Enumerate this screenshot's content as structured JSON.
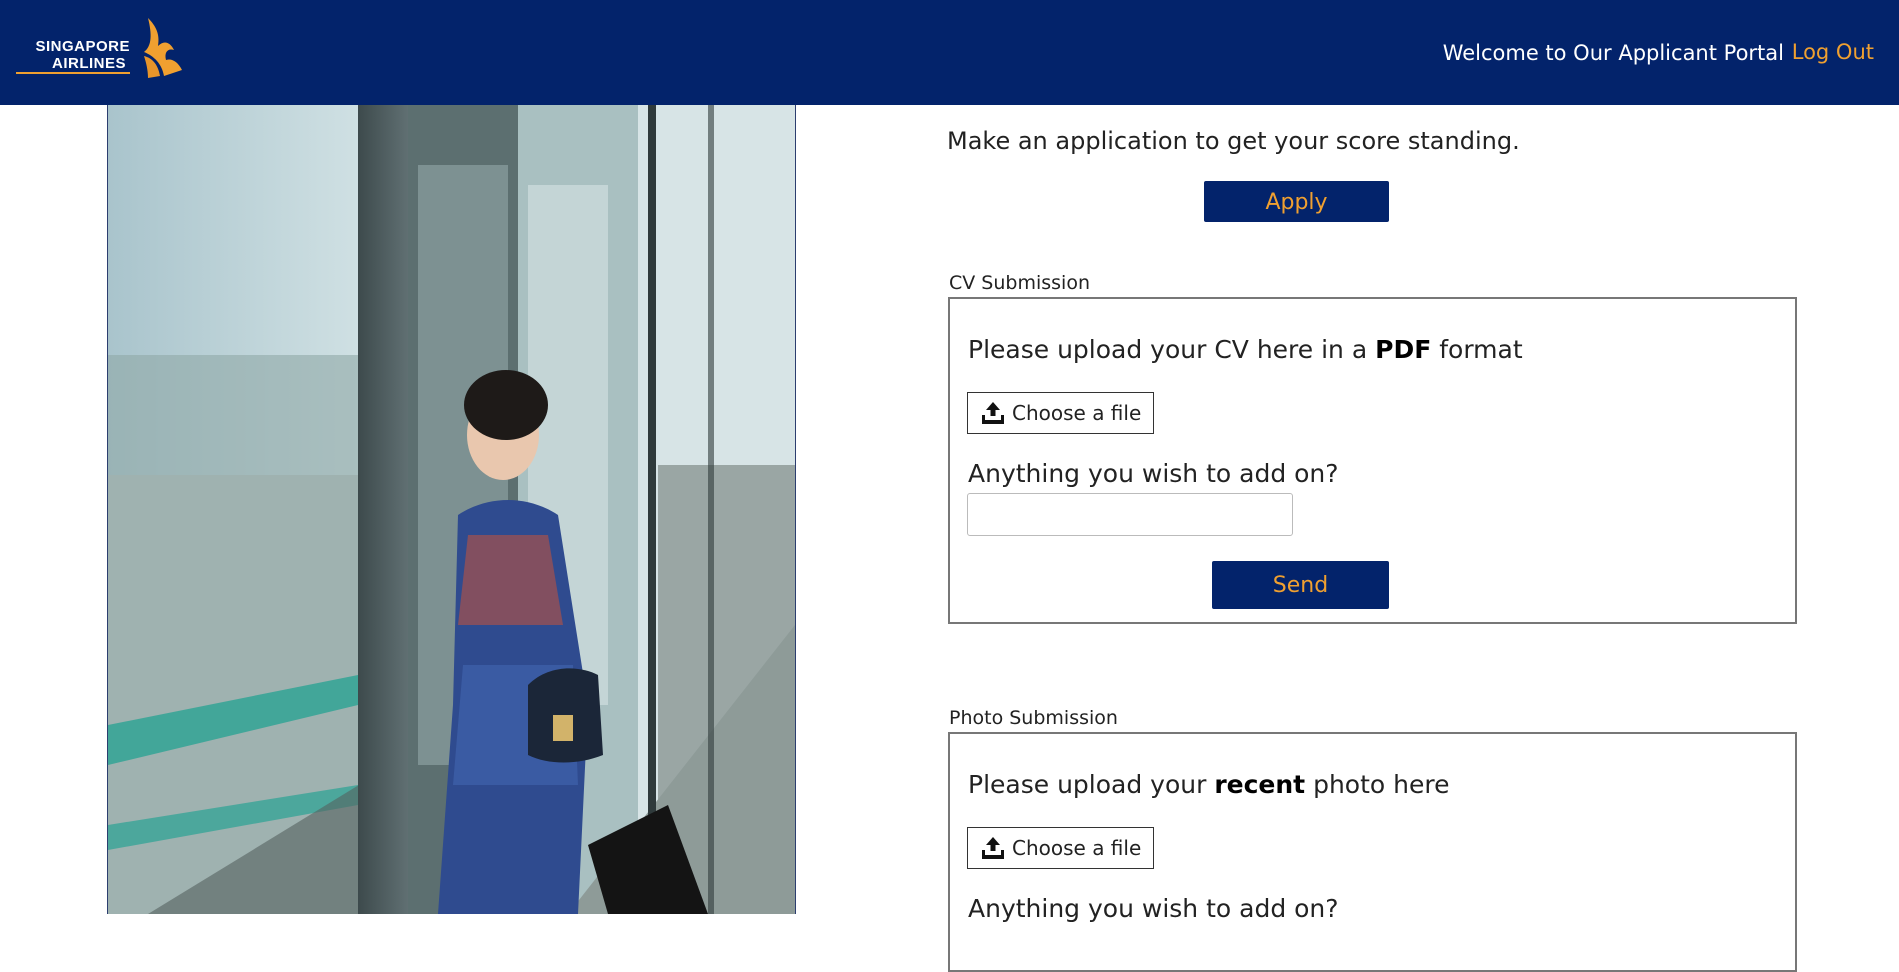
{
  "header": {
    "logo_line1": "SINGAPORE",
    "logo_line2": "AIRLINES",
    "welcome": "Welcome to Our Applicant Portal",
    "logout": "Log Out"
  },
  "main": {
    "intro": "Make an application to get your score standing.",
    "apply_label": "Apply"
  },
  "cv_section": {
    "legend": "CV Submission",
    "heading_pre": "Please upload your CV here in a ",
    "heading_bold": "PDF",
    "heading_post": " format",
    "file_label": "Choose a file",
    "addon_label": "Anything you wish to add on?",
    "addon_value": "",
    "send_label": "Send"
  },
  "photo_section": {
    "legend": "Photo Submission",
    "heading_pre": "Please upload your ",
    "heading_bold": "recent",
    "heading_post": " photo here",
    "file_label": "Choose a file",
    "addon_label": "Anything you wish to add on?"
  },
  "icons": {
    "upload": "upload-icon",
    "logo": "singapore-airlines-bird-icon"
  },
  "colors": {
    "navy": "#03236b",
    "accent": "#f0a030"
  }
}
